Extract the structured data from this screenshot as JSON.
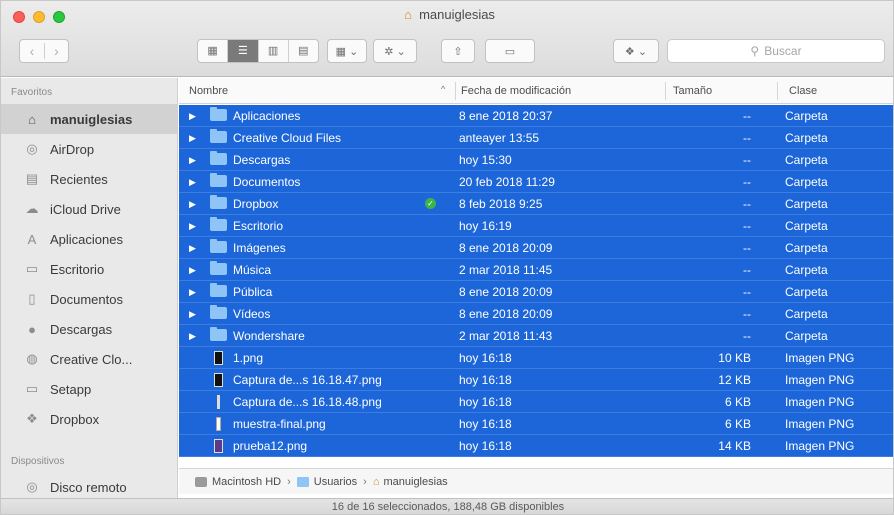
{
  "window": {
    "title": "manuiglesias"
  },
  "toolbar": {
    "back_icon": "‹",
    "forward_icon": "›",
    "search_placeholder": "Buscar"
  },
  "sidebar": {
    "favorites_heading": "Favoritos",
    "items": [
      {
        "label": "manuiglesias",
        "icon": "home-icon",
        "selected": true
      },
      {
        "label": "AirDrop",
        "icon": "airdrop-icon"
      },
      {
        "label": "Recientes",
        "icon": "recents-icon"
      },
      {
        "label": "iCloud Drive",
        "icon": "cloud-icon"
      },
      {
        "label": "Aplicaciones",
        "icon": "applications-icon"
      },
      {
        "label": "Escritorio",
        "icon": "desktop-icon"
      },
      {
        "label": "Documentos",
        "icon": "documents-icon"
      },
      {
        "label": "Descargas",
        "icon": "downloads-icon"
      },
      {
        "label": "Creative Clo...",
        "icon": "creative-cloud-icon"
      },
      {
        "label": "Setapp",
        "icon": "folder-icon"
      },
      {
        "label": "Dropbox",
        "icon": "dropbox-icon"
      }
    ],
    "devices_heading": "Dispositivos",
    "devices": [
      {
        "label": "Disco remoto",
        "icon": "remote-disc-icon"
      }
    ]
  },
  "columns": {
    "name": "Nombre",
    "date": "Fecha de modificación",
    "size": "Tamaño",
    "kind": "Clase"
  },
  "files": [
    {
      "name": "Aplicaciones",
      "date": "8 ene 2018 20:37",
      "size": "--",
      "kind": "Carpeta",
      "type": "folder"
    },
    {
      "name": "Creative Cloud Files",
      "date": "anteayer 13:55",
      "size": "--",
      "kind": "Carpeta",
      "type": "folder"
    },
    {
      "name": "Descargas",
      "date": "hoy 15:30",
      "size": "--",
      "kind": "Carpeta",
      "type": "folder"
    },
    {
      "name": "Documentos",
      "date": "20 feb 2018 11:29",
      "size": "--",
      "kind": "Carpeta",
      "type": "folder"
    },
    {
      "name": "Dropbox",
      "date": "8 feb 2018 9:25",
      "size": "--",
      "kind": "Carpeta",
      "type": "folder",
      "synced": true
    },
    {
      "name": "Escritorio",
      "date": "hoy 16:19",
      "size": "--",
      "kind": "Carpeta",
      "type": "folder"
    },
    {
      "name": "Imágenes",
      "date": "8 ene 2018 20:09",
      "size": "--",
      "kind": "Carpeta",
      "type": "folder"
    },
    {
      "name": "Música",
      "date": "2 mar 2018 11:45",
      "size": "--",
      "kind": "Carpeta",
      "type": "folder"
    },
    {
      "name": "Pública",
      "date": "8 ene 2018 20:09",
      "size": "--",
      "kind": "Carpeta",
      "type": "folder"
    },
    {
      "name": "Vídeos",
      "date": "8 ene 2018 20:09",
      "size": "--",
      "kind": "Carpeta",
      "type": "folder"
    },
    {
      "name": "Wondershare",
      "date": "2 mar 2018 11:43",
      "size": "--",
      "kind": "Carpeta",
      "type": "folder"
    },
    {
      "name": "1.png",
      "date": "hoy 16:18",
      "size": "10 KB",
      "kind": "Imagen PNG",
      "type": "black"
    },
    {
      "name": "Captura de...s 16.18.47.png",
      "date": "hoy 16:18",
      "size": "12 KB",
      "kind": "Imagen PNG",
      "type": "black"
    },
    {
      "name": "Captura de...s 16.18.48.png",
      "date": "hoy 16:18",
      "size": "6 KB",
      "kind": "Imagen PNG",
      "type": "thin"
    },
    {
      "name": "muestra-final.png",
      "date": "hoy 16:18",
      "size": "6 KB",
      "kind": "Imagen PNG",
      "type": "thin2"
    },
    {
      "name": "prueba12.png",
      "date": "hoy 16:18",
      "size": "14 KB",
      "kind": "Imagen PNG",
      "type": "purple"
    }
  ],
  "pathbar": {
    "items": [
      "Macintosh HD",
      "Usuarios",
      "manuiglesias"
    ]
  },
  "status": {
    "text": "16 de 16 seleccionados, 188,48 GB disponibles"
  },
  "colors": {
    "selection": "#1d66d9",
    "folder": "#8ec5f6",
    "sync_ok": "#3bb54a"
  }
}
